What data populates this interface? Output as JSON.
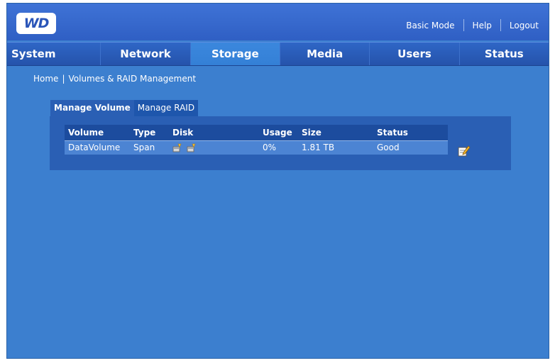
{
  "header": {
    "logo_text": "WD",
    "links": {
      "basic_mode": "Basic Mode",
      "help": "Help",
      "logout": "Logout"
    }
  },
  "nav": {
    "tabs": [
      {
        "label": "System"
      },
      {
        "label": "Network"
      },
      {
        "label": "Storage"
      },
      {
        "label": "Media"
      },
      {
        "label": "Users"
      },
      {
        "label": "Status"
      }
    ],
    "active": "Storage"
  },
  "breadcrumb": {
    "home": "Home",
    "separator": "|",
    "current": "Volumes & RAID Management"
  },
  "subtabs": {
    "manage_volume": "Manage Volume",
    "manage_raid": "Manage RAID"
  },
  "volume_table": {
    "headers": {
      "volume": "Volume",
      "type": "Type",
      "disk": "Disk",
      "usage": "Usage",
      "size": "Size",
      "status": "Status"
    },
    "rows": [
      {
        "volume": "DataVolume",
        "type": "Span",
        "disk_icons": [
          "disk-icon",
          "disk-icon"
        ],
        "usage": "0%",
        "size": "1.81 TB",
        "status": "Good"
      }
    ]
  },
  "icons": {
    "edit": "edit-icon"
  },
  "colors": {
    "background": "#3c7fcf",
    "header": "#2f5fc4",
    "panel": "#2a5fb4",
    "table_header": "#1c4c9e",
    "table_row": "#4c84d3"
  }
}
